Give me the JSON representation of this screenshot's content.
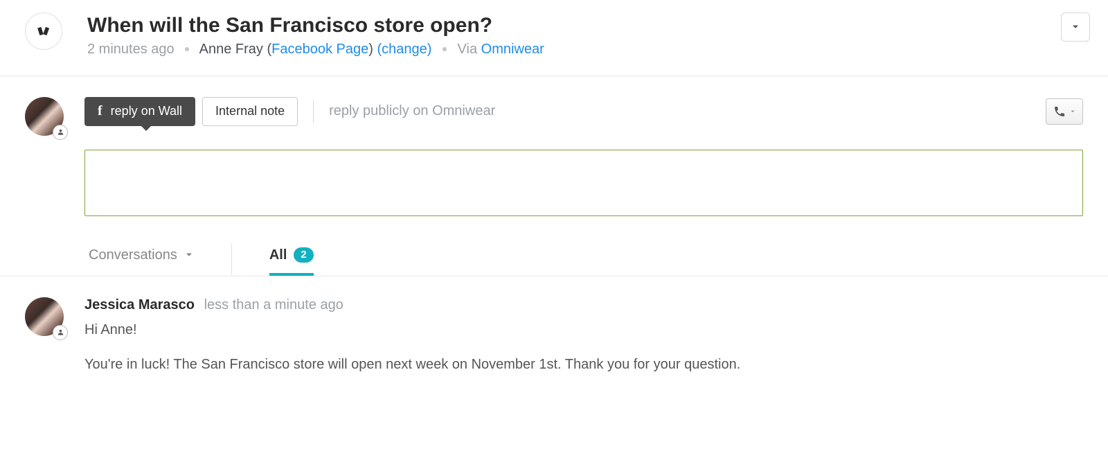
{
  "header": {
    "title": "When will the San Francisco store open?",
    "time": "2 minutes ago",
    "author": "Anne Fray",
    "channel_label": "Facebook Page",
    "change_label": "(change)",
    "via_prefix": "Via",
    "via_link": "Omniwear"
  },
  "toolbar": {
    "reply_wall": "reply on Wall",
    "internal_note": "Internal note",
    "reply_public": "reply publicly on Omniwear"
  },
  "tabs": {
    "conversations": "Conversations",
    "all": "All",
    "all_count": "2"
  },
  "message": {
    "author": "Jessica Marasco",
    "time": "less than a minute ago",
    "line1": "Hi Anne!",
    "line2": "You're in luck! The San Francisco store will open next week on November 1st. Thank you for your question."
  }
}
